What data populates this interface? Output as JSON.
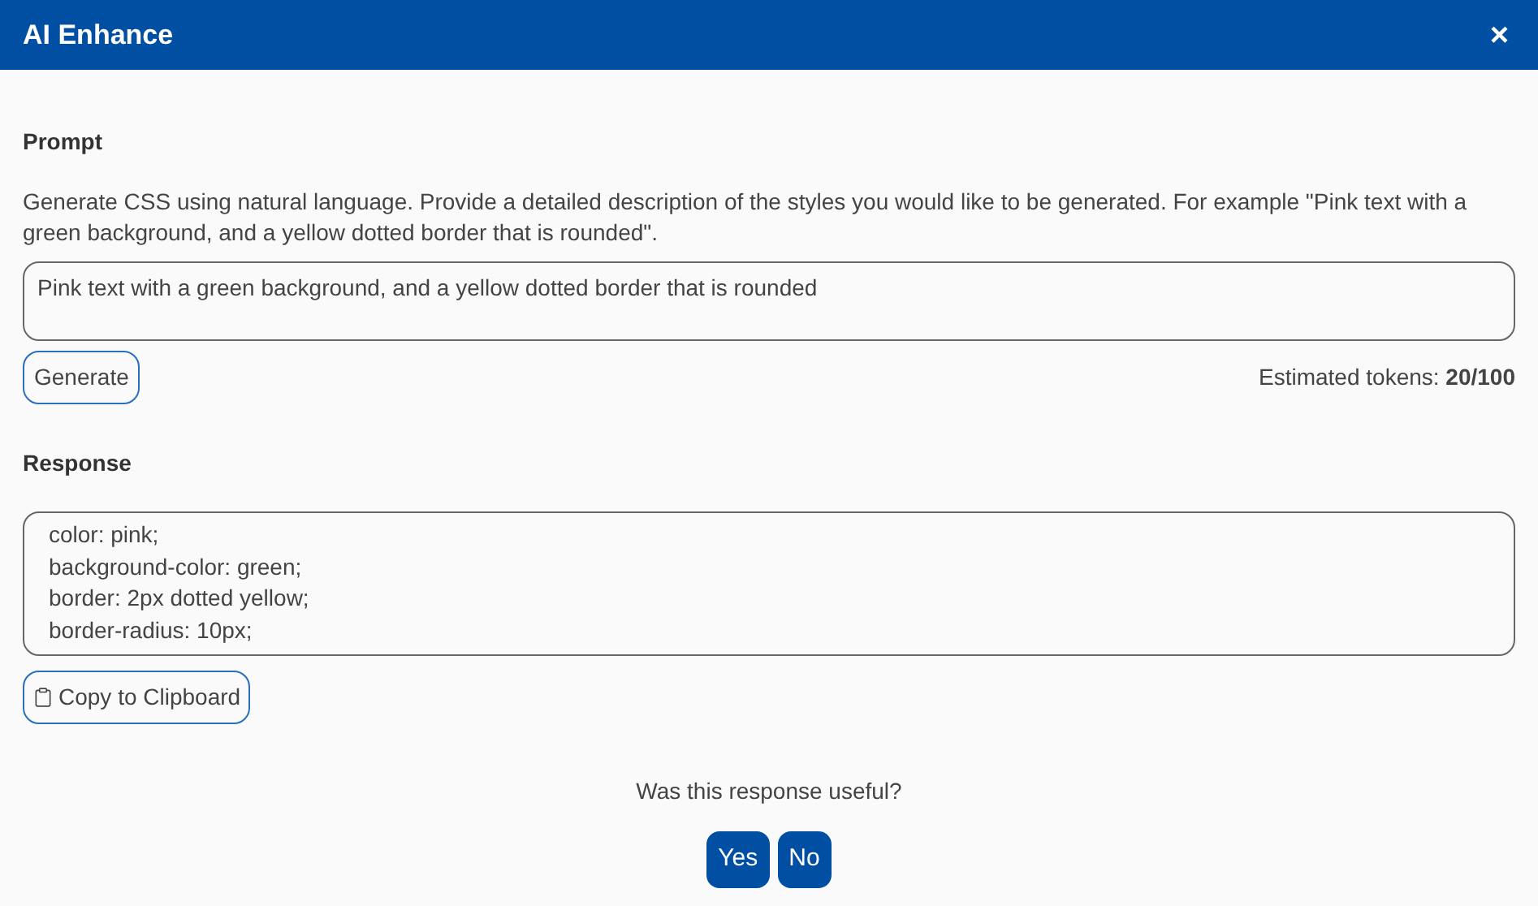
{
  "dialog": {
    "title": "AI Enhance",
    "close": "×"
  },
  "prompt": {
    "label": "Prompt",
    "description": "Generate CSS using natural language. Provide a detailed description of the styles you would like to be generated. For example \"Pink text with a green background, and a yellow dotted border that is rounded\".",
    "value": "Pink text with a green background, and a yellow dotted border that is rounded",
    "generate": "Generate",
    "tokens": "Estimated tokens: **20/100**"
  },
  "response": {
    "label": "Response",
    "lines": [
      "color: pink;",
      "background-color: green;",
      "border: 2px dotted yellow;",
      "border-radius: 10px;"
    ],
    "copy": "Copy to Clipboard"
  },
  "feedback": {
    "question": "Was this response useful?",
    "buttons": [
      "Yes",
      "No"
    ]
  }
}
